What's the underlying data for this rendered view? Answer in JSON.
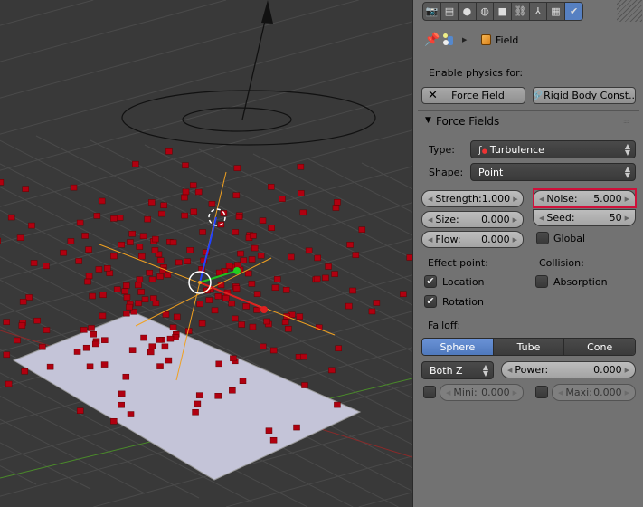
{
  "properties": {
    "tabs": [
      {
        "icon": "camera-icon",
        "active": false
      },
      {
        "icon": "render-layers-icon",
        "active": false
      },
      {
        "icon": "scene-icon",
        "active": false
      },
      {
        "icon": "world-icon",
        "active": false
      },
      {
        "icon": "object-icon",
        "active": false
      },
      {
        "icon": "constraints-icon",
        "active": false
      },
      {
        "icon": "object-data-icon",
        "active": false
      },
      {
        "icon": "texture-icon",
        "active": false
      },
      {
        "icon": "physics-icon",
        "active": true
      }
    ],
    "breadcrumb": {
      "object_name": "Field"
    },
    "enable_physics_label": "Enable physics for:",
    "force_field_button": "Force Field",
    "rigid_body_button": "Rigid Body Const...",
    "panel_title": "Force Fields",
    "type_label": "Type:",
    "type_value": "Turbulence",
    "shape_label": "Shape:",
    "shape_value": "Point",
    "strength": {
      "label": "Strength:",
      "value": "1.000"
    },
    "size": {
      "label": "Size:",
      "value": "0.000"
    },
    "flow": {
      "label": "Flow:",
      "value": "0.000"
    },
    "noise": {
      "label": "Noise:",
      "value": "5.000",
      "highlighted": true,
      "highlight_color": "#d0103a"
    },
    "seed": {
      "label": "Seed:",
      "value": "50"
    },
    "global": {
      "label": "Global",
      "checked": false
    },
    "effect_point_label": "Effect point:",
    "location": {
      "label": "Location",
      "checked": true
    },
    "rotation": {
      "label": "Rotation",
      "checked": true
    },
    "collision_label": "Collision:",
    "absorption": {
      "label": "Absorption",
      "checked": false
    },
    "falloff_label": "Falloff:",
    "falloff_options": [
      "Sphere",
      "Tube",
      "Cone"
    ],
    "falloff_selected": "Sphere",
    "z_direction": "Both Z",
    "power": {
      "label": "Power:",
      "value": "0.000"
    },
    "mini": {
      "label": "Mini:",
      "value": "0.000",
      "enabled": false
    },
    "maxi": {
      "label": "Maxi:",
      "value": "0.000",
      "enabled": false
    }
  },
  "colors": {
    "accent": "#5680c2",
    "particles": "#b00010",
    "plane": "#c8c8dc",
    "viewport_bg": "#393939"
  }
}
